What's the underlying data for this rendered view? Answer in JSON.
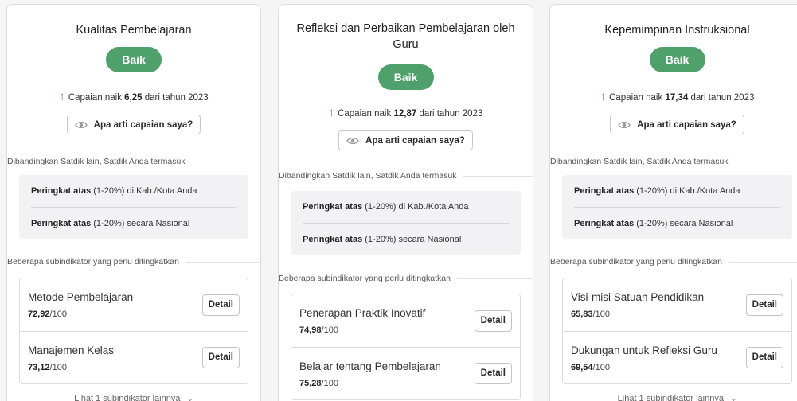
{
  "cards": [
    {
      "title": "Kualitas Pembelajaran",
      "badge": "Baik",
      "achievement": {
        "prefix": "Capaian naik",
        "value": "6,25",
        "suffix": "dari tahun 2023"
      },
      "info_button": "Apa arti capaian saya?",
      "comparison_title": "Dibandingkan Satdik lain, Satdik Anda termasuk",
      "rankings": [
        {
          "rank": "Peringkat atas",
          "detail": "(1-20%) di Kab./Kota Anda"
        },
        {
          "rank": "Peringkat atas",
          "detail": "(1-20%) secara Nasional"
        }
      ],
      "subindicator_title": "Beberapa subindikator yang perlu ditingkatkan",
      "subindicators": [
        {
          "name": "Metode Pembelajaran",
          "score": "72,92",
          "max": "/100",
          "button": "Detail"
        },
        {
          "name": "Manajemen Kelas",
          "score": "73,12",
          "max": "/100",
          "button": "Detail"
        }
      ],
      "more_link": "Lihat 1 subindikator lainnya"
    },
    {
      "title": "Refleksi dan Perbaikan Pembelajaran oleh Guru",
      "badge": "Baik",
      "achievement": {
        "prefix": "Capaian naik",
        "value": "12,87",
        "suffix": "dari tahun 2023"
      },
      "info_button": "Apa arti capaian saya?",
      "comparison_title": "Dibandingkan Satdik lain, Satdik Anda termasuk",
      "rankings": [
        {
          "rank": "Peringkat atas",
          "detail": "(1-20%) di Kab./Kota Anda"
        },
        {
          "rank": "Peringkat atas",
          "detail": "(1-20%) secara Nasional"
        }
      ],
      "subindicator_title": "Beberapa subindikator yang perlu ditingkatkan",
      "subindicators": [
        {
          "name": "Penerapan Praktik Inovatif",
          "score": "74,98",
          "max": "/100",
          "button": "Detail"
        },
        {
          "name": "Belajar tentang Pembelajaran",
          "score": "75,28",
          "max": "/100",
          "button": "Detail"
        }
      ],
      "more_link": ""
    },
    {
      "title": "Kepemimpinan Instruksional",
      "badge": "Baik",
      "achievement": {
        "prefix": "Capaian naik",
        "value": "17,34",
        "suffix": "dari tahun 2023"
      },
      "info_button": "Apa arti capaian saya?",
      "comparison_title": "Dibandingkan Satdik lain, Satdik Anda termasuk",
      "rankings": [
        {
          "rank": "Peringkat atas",
          "detail": "(1-20%) di Kab./Kota Anda"
        },
        {
          "rank": "Peringkat atas",
          "detail": "(1-20%) secara Nasional"
        }
      ],
      "subindicator_title": "Beberapa subindikator yang perlu ditingkatkan",
      "subindicators": [
        {
          "name": "Visi-misi Satuan Pendidikan",
          "score": "65,83",
          "max": "/100",
          "button": "Detail"
        },
        {
          "name": "Dukungan untuk Refleksi Guru",
          "score": "69,54",
          "max": "/100",
          "button": "Detail"
        }
      ],
      "more_link": "Lihat 1 subindikator lainnya"
    }
  ],
  "colors": {
    "badge": "#4fa16b",
    "arrow": "#3d9a5f",
    "rank_bg": "#f2f2f4"
  },
  "icons": {
    "achievement": "arrow-up-icon",
    "info": "eye-icon",
    "more": "chevron-down-icon"
  }
}
